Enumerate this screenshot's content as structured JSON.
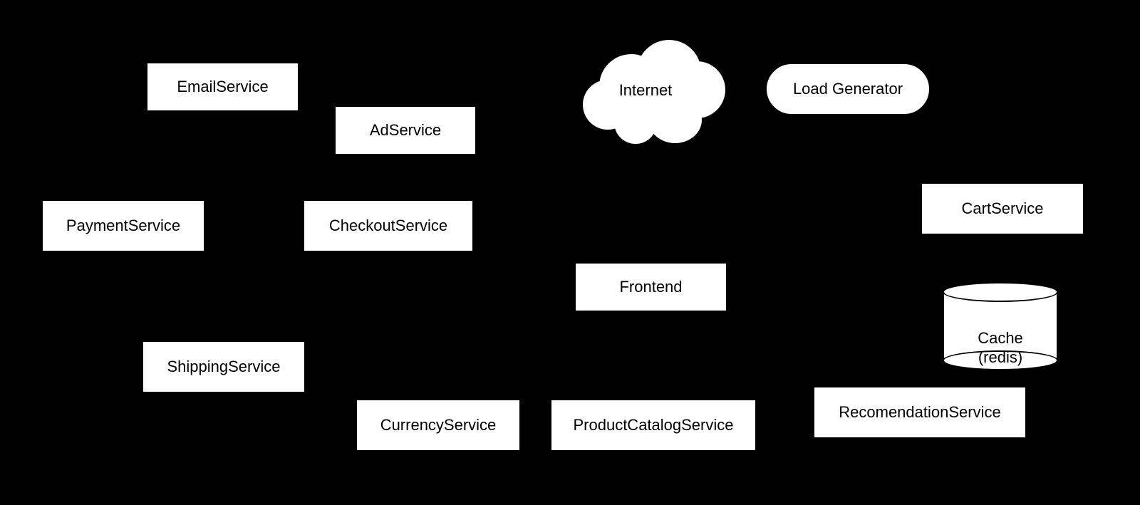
{
  "nodes": {
    "email": {
      "label": "EmailService"
    },
    "ad": {
      "label": "AdService"
    },
    "internet": {
      "label": "Internet"
    },
    "loadgen": {
      "label": "Load Generator"
    },
    "payment": {
      "label": "PaymentService"
    },
    "checkout": {
      "label": "CheckoutService"
    },
    "cart": {
      "label": "CartService"
    },
    "frontend": {
      "label": "Frontend"
    },
    "shipping": {
      "label": "ShippingService"
    },
    "currency": {
      "label": "CurrencyService"
    },
    "productcatalog": {
      "label": "ProductCatalogService"
    },
    "recommendation": {
      "label": "RecomendationService"
    },
    "cache": {
      "label": "Cache\n(redis)"
    }
  }
}
